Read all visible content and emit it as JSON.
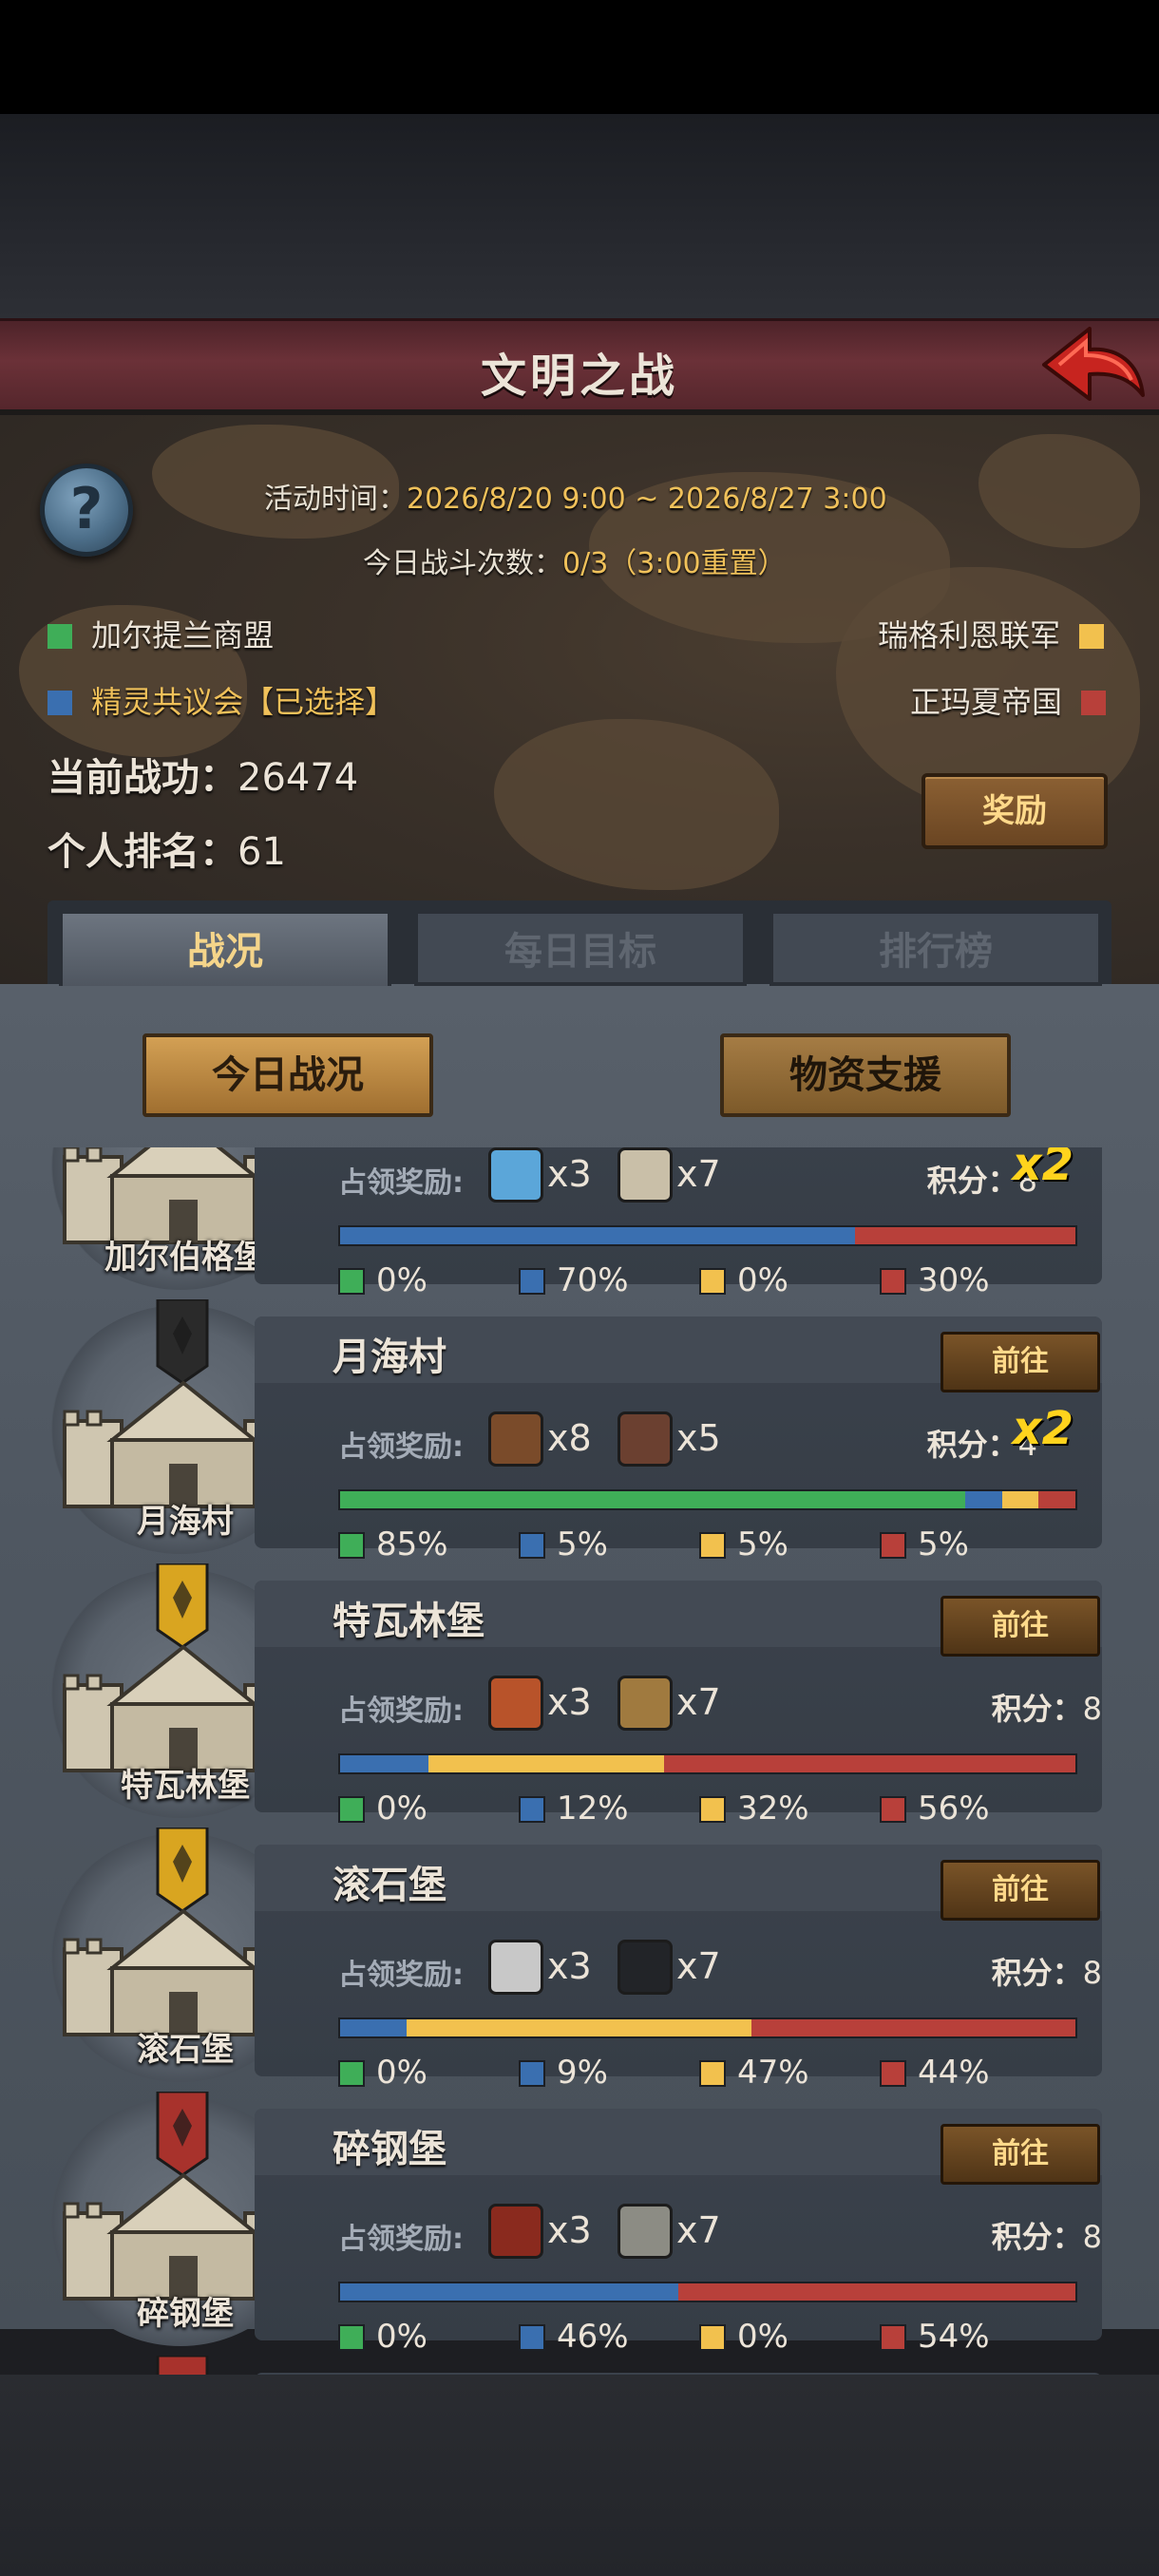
{
  "header": {
    "title": "文明之战"
  },
  "event": {
    "time_label": "活动时间：",
    "time_value": "2026/8/20 9:00 ~ 2026/8/27 3:00",
    "battles_label": "今日战斗次数：",
    "battles_value": "0/3（3:00重置）"
  },
  "factions": [
    {
      "name": "加尔提兰商盟",
      "color": "#3fae58"
    },
    {
      "name": "瑞格利恩联军",
      "color": "#f2c14e"
    },
    {
      "name": "精灵共议会【已选择】",
      "color": "#3a6fb0"
    },
    {
      "name": "正玛夏帝国",
      "color": "#b8403a"
    }
  ],
  "player": {
    "merit_label": "当前战功：",
    "merit_value": "26474",
    "rank_label": "个人排名：",
    "rank_value": "61"
  },
  "reward_button": "奖励",
  "tabs": [
    {
      "label": "战况",
      "active": true
    },
    {
      "label": "每日目标",
      "active": false
    },
    {
      "label": "排行榜",
      "active": false
    }
  ],
  "sub_buttons": {
    "today": "今日战况",
    "support": "物资支援"
  },
  "common": {
    "reward_label": "占领奖励:",
    "score_label": "积分：",
    "go_label": "前往"
  },
  "locations": [
    {
      "name": "加尔伯格堡",
      "label": "加尔伯格堡",
      "banner_color": "#a8322c",
      "rewards": [
        {
          "icon": "blue-cloth-icon",
          "qty": "x3"
        },
        {
          "icon": "scroll-icon",
          "qty": "x7"
        }
      ],
      "score": "8",
      "multiplier": "x2",
      "shares": [
        0,
        70,
        0,
        30
      ],
      "pcts": [
        "0%",
        "70%",
        "0%",
        "30%"
      ]
    },
    {
      "name": "月海村",
      "label": "月海村",
      "banner_color": "#2a2a2a",
      "rewards": [
        {
          "icon": "horse-icon",
          "qty": "x8"
        },
        {
          "icon": "boar-icon",
          "qty": "x5"
        }
      ],
      "score": "4",
      "multiplier": "x2",
      "shares": [
        85,
        5,
        5,
        5
      ],
      "pcts": [
        "85%",
        "5%",
        "5%",
        "5%"
      ]
    },
    {
      "name": "特瓦林堡",
      "label": "特瓦林堡",
      "banner_color": "#d9a520",
      "rewards": [
        {
          "icon": "wood-plank-icon",
          "qty": "x3"
        },
        {
          "icon": "log-icon",
          "qty": "x7"
        }
      ],
      "score": "8",
      "multiplier": "",
      "shares": [
        0,
        12,
        32,
        56
      ],
      "pcts": [
        "0%",
        "12%",
        "32%",
        "56%"
      ]
    },
    {
      "name": "滚石堡",
      "label": "滚石堡",
      "banner_color": "#d9a520",
      "rewards": [
        {
          "icon": "stone-block-icon",
          "qty": "x3"
        },
        {
          "icon": "iron-ingot-icon",
          "qty": "x7"
        }
      ],
      "score": "8",
      "multiplier": "",
      "shares": [
        0,
        9,
        47,
        44
      ],
      "pcts": [
        "0%",
        "9%",
        "47%",
        "44%"
      ]
    },
    {
      "name": "碎钢堡",
      "label": "碎钢堡",
      "banner_color": "#a8322c",
      "rewards": [
        {
          "icon": "ore-chest-icon",
          "qty": "x3"
        },
        {
          "icon": "rock-icon",
          "qty": "x7"
        }
      ],
      "score": "8",
      "multiplier": "",
      "shares": [
        0,
        46,
        0,
        54
      ],
      "pcts": [
        "0%",
        "46%",
        "0%",
        "54%"
      ]
    }
  ],
  "colors": {
    "green": "#3fae58",
    "blue": "#3a6fb0",
    "yellow": "#f2c14e",
    "red": "#b8403a"
  }
}
